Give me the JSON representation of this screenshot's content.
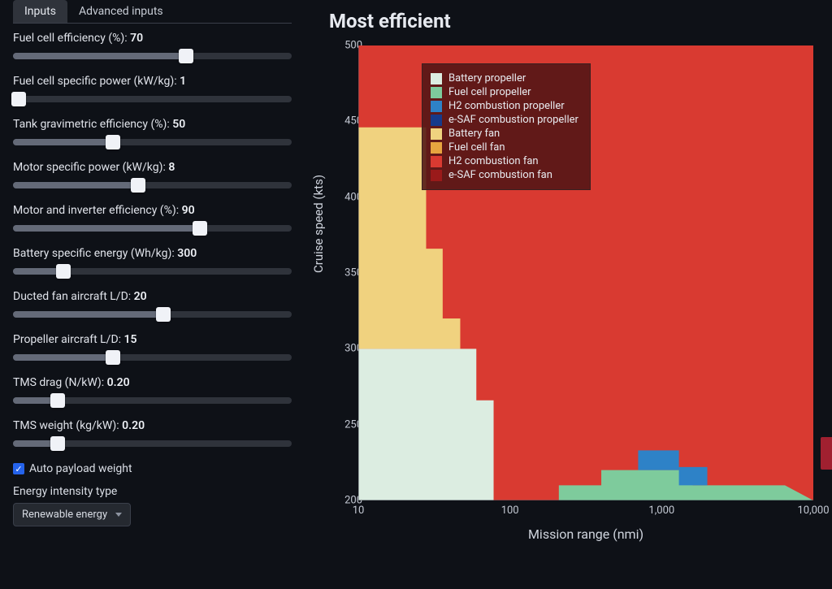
{
  "tabs": {
    "inputs": "Inputs",
    "advanced": "Advanced inputs"
  },
  "sliders": [
    {
      "label": "Fuel cell efficiency (%)",
      "value": 70,
      "display": "70",
      "pct": 62
    },
    {
      "label": "Fuel cell specific power (kW/kg)",
      "value": 1,
      "display": "1",
      "pct": 2
    },
    {
      "label": "Tank gravimetric efficiency (%)",
      "value": 50,
      "display": "50",
      "pct": 36
    },
    {
      "label": "Motor specific power (kW/kg)",
      "value": 8,
      "display": "8",
      "pct": 45
    },
    {
      "label": "Motor and inverter efficiency (%)",
      "value": 90,
      "display": "90",
      "pct": 67
    },
    {
      "label": "Battery specific energy (Wh/kg)",
      "value": 300,
      "display": "300",
      "pct": 18
    },
    {
      "label": "Ducted fan aircraft L/D",
      "value": 20,
      "display": "20",
      "pct": 54
    },
    {
      "label": "Propeller aircraft L/D",
      "value": 15,
      "display": "15",
      "pct": 36
    },
    {
      "label": "TMS drag (N/kW)",
      "value": 0.2,
      "display": "0.20",
      "pct": 16
    },
    {
      "label": "TMS weight (kg/kW)",
      "value": 0.2,
      "display": "0.20",
      "pct": 16
    }
  ],
  "checkbox": {
    "label": "Auto payload weight",
    "checked": true
  },
  "select": {
    "label": "Energy intensity type",
    "value": "Renewable energy"
  },
  "chart_data": {
    "type": "heatmap",
    "title": "Most efficient",
    "xlabel": "Mission range (nmi)",
    "ylabel": "Cruise speed (kts)",
    "xscale": "log",
    "xlim": [
      10,
      10000
    ],
    "ylim": [
      200,
      500
    ],
    "xticks": [
      10,
      100,
      1000,
      10000
    ],
    "xtick_labels": [
      "10",
      "100",
      "1,000",
      "10,000"
    ],
    "yticks": [
      200,
      250,
      300,
      350,
      400,
      450,
      500
    ],
    "legend": [
      {
        "name": "Battery propeller",
        "color": "#dcede1"
      },
      {
        "name": "Fuel cell propeller",
        "color": "#7ecb9c"
      },
      {
        "name": "H2 combustion propeller",
        "color": "#2e82c7"
      },
      {
        "name": "e-SAF combustion propeller",
        "color": "#173a8a"
      },
      {
        "name": "Battery fan",
        "color": "#f0d27f"
      },
      {
        "name": "Fuel cell fan",
        "color": "#e7a43f"
      },
      {
        "name": "H2 combustion fan",
        "color": "#d93a31"
      },
      {
        "name": "e-SAF combustion fan",
        "color": "#9a1a1a"
      }
    ],
    "regions": [
      {
        "category": "H2 combustion fan",
        "x_range": [
          10,
          10000
        ],
        "y_range": [
          200,
          500
        ],
        "note": "background default"
      },
      {
        "category": "Battery fan",
        "step_outline_x": [
          10,
          28,
          28,
          36,
          36,
          47,
          47
        ],
        "step_outline_y": [
          446,
          446,
          366,
          366,
          320,
          320,
          300
        ],
        "note": "upper-left yellow stepped block, y>=300"
      },
      {
        "category": "Battery propeller",
        "step_outline_x": [
          10,
          60,
          60,
          78,
          78,
          100,
          100
        ],
        "step_outline_y": [
          300,
          300,
          266,
          266,
          200,
          200,
          200
        ],
        "note": "lower-left beige stepped block, y<=300"
      },
      {
        "category": "Fuel cell propeller",
        "step_outline_x": [
          100,
          210,
          210,
          400,
          400,
          1600,
          1600,
          6500,
          6500,
          10000
        ],
        "step_outline_y": [
          200,
          200,
          210,
          210,
          220,
          220,
          210,
          210,
          210,
          200
        ],
        "note": "green bottom band"
      },
      {
        "category": "H2 combustion propeller",
        "step_outline_x": [
          700,
          1300,
          1300,
          2000
        ],
        "step_outline_y": [
          220,
          220,
          233,
          233
        ],
        "note": "small blue block sitting on green band"
      }
    ]
  }
}
